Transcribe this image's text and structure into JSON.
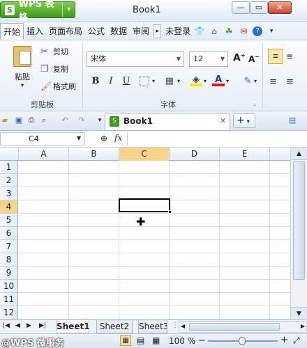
{
  "app": {
    "button_label": "WPS 表格",
    "logo_letter": "S",
    "doc_title": "Book1"
  },
  "window": {
    "minimize": "—",
    "restore": "▭",
    "close": "✕"
  },
  "menu": {
    "tabs": [
      "开始",
      "插入",
      "页面布局",
      "公式",
      "数据",
      "审阅"
    ],
    "login": "未登录"
  },
  "ribbon": {
    "clipboard": {
      "paste": "粘贴",
      "cut": "剪切",
      "copy": "复制",
      "format_painter": "格式刷",
      "group_label": "剪贴板"
    },
    "font": {
      "name": "宋体",
      "size": "12",
      "group_label": "字体",
      "bold": "B",
      "italic": "I",
      "underline": "U",
      "grow": "A",
      "shrink": "A"
    }
  },
  "quickbar": {
    "doc_tab": "Book1",
    "new_tab": "+"
  },
  "formula": {
    "namebox": "C4",
    "fx": "fx"
  },
  "grid": {
    "columns": [
      "A",
      "B",
      "C",
      "D",
      "E"
    ],
    "rows": [
      "1",
      "2",
      "3",
      "4",
      "5",
      "6",
      "7",
      "8",
      "9",
      "10",
      "11",
      "12"
    ],
    "selected_col": "C",
    "selected_row": "4"
  },
  "sheets": [
    "Sheet1",
    "Sheet2",
    "Sheet3"
  ],
  "status": {
    "watermark": "@WPS 微服务",
    "zoom": "100 %"
  },
  "colors": {
    "accent_green": "#3f9a1f",
    "selection": "#f5d58c"
  }
}
